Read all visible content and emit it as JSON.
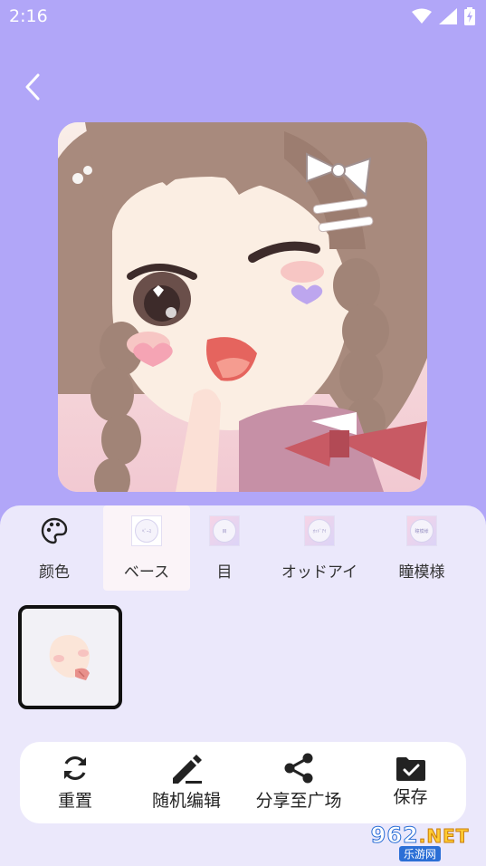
{
  "status_bar": {
    "time": "2:16",
    "icons": [
      "wifi-icon",
      "signal-icon",
      "battery-icon"
    ]
  },
  "back_button": {
    "icon": "chevron-left-icon"
  },
  "tabs": [
    {
      "label": "颜色",
      "icon": "palette-icon",
      "active": false
    },
    {
      "label": "ベース",
      "icon": "base-thumbnail",
      "active": true
    },
    {
      "label": "目",
      "icon": "eye-thumbnail",
      "active": false
    },
    {
      "label": "オッドアイ",
      "icon": "odd-eye-thumbnail",
      "active": false
    },
    {
      "label": "瞳模様",
      "icon": "pupil-pattern-thumbnail",
      "active": false
    }
  ],
  "thumb_text": {
    "base": "ﾍﾞｰｽ",
    "eye": "目",
    "odd_eye": "ｵｯﾄﾞｱｲ",
    "pupil": "瞳模様"
  },
  "parts": [
    {
      "name": "base-face-option",
      "selected": true
    }
  ],
  "actions": [
    {
      "label": "重置",
      "icon": "refresh-icon"
    },
    {
      "label": "随机编辑",
      "icon": "pencil-icon"
    },
    {
      "label": "分享至广场",
      "icon": "share-icon"
    },
    {
      "label": "保存",
      "icon": "folder-check-icon"
    }
  ],
  "watermark": {
    "digits": "962",
    "suffix": ".NET",
    "sub": "乐游网"
  },
  "colors": {
    "background": "#b1a6f8",
    "panel": "#ebe8fb",
    "active_tab": "#fbf4f8",
    "action_bar": "#ffffff"
  }
}
